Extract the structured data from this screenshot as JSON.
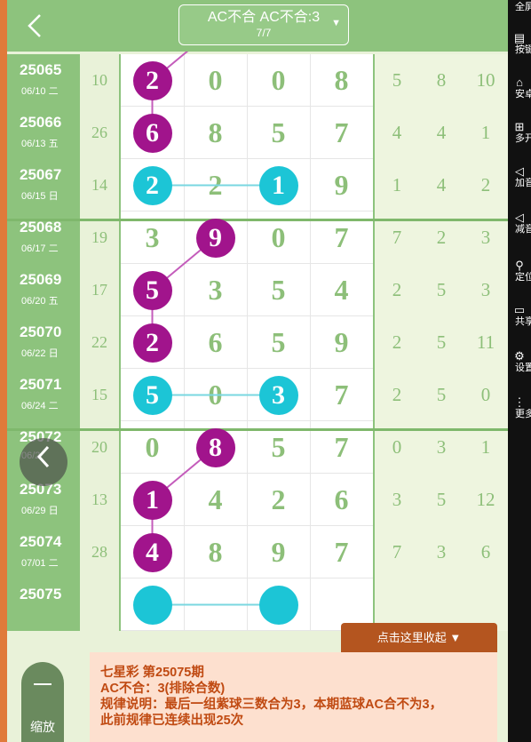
{
  "header": {
    "back_icon": "chevron-left-icon",
    "title": "AC不合 AC不合:3",
    "subtitle": "7/7",
    "dropdown_icon": "▼"
  },
  "rows": [
    {
      "issue": "25065",
      "date": "06/10 二",
      "sum": "10",
      "digits": [
        "2",
        "0",
        "0",
        "8"
      ],
      "side": [
        "5",
        "8",
        "10"
      ]
    },
    {
      "issue": "25066",
      "date": "06/13 五",
      "sum": "26",
      "digits": [
        "6",
        "8",
        "5",
        "7"
      ],
      "side": [
        "4",
        "4",
        "1"
      ]
    },
    {
      "issue": "25067",
      "date": "06/15 日",
      "sum": "14",
      "digits": [
        "2",
        "2",
        "1",
        "9"
      ],
      "side": [
        "1",
        "4",
        "2"
      ]
    },
    {
      "issue": "25068",
      "date": "06/17 二",
      "sum": "19",
      "digits": [
        "3",
        "9",
        "0",
        "7"
      ],
      "side": [
        "7",
        "2",
        "3"
      ]
    },
    {
      "issue": "25069",
      "date": "06/20 五",
      "sum": "17",
      "digits": [
        "5",
        "3",
        "5",
        "4"
      ],
      "side": [
        "2",
        "5",
        "3"
      ]
    },
    {
      "issue": "25070",
      "date": "06/22 日",
      "sum": "22",
      "digits": [
        "2",
        "6",
        "5",
        "9"
      ],
      "side": [
        "2",
        "5",
        "11"
      ]
    },
    {
      "issue": "25071",
      "date": "06/24 二",
      "sum": "15",
      "digits": [
        "5",
        "0",
        "3",
        "7"
      ],
      "side": [
        "2",
        "5",
        "0"
      ]
    },
    {
      "issue": "25072",
      "date": "06/2",
      "sum": "20",
      "digits": [
        "0",
        "8",
        "5",
        "7"
      ],
      "side": [
        "0",
        "3",
        "1"
      ]
    },
    {
      "issue": "25073",
      "date": "06/29 日",
      "sum": "13",
      "digits": [
        "1",
        "4",
        "2",
        "6"
      ],
      "side": [
        "3",
        "5",
        "12"
      ]
    },
    {
      "issue": "25074",
      "date": "07/01 二",
      "sum": "28",
      "digits": [
        "4",
        "8",
        "9",
        "7"
      ],
      "side": [
        "7",
        "3",
        "6"
      ]
    },
    {
      "issue": "25075",
      "date": "",
      "sum": "",
      "digits": [
        "",
        "",
        "",
        ""
      ],
      "side": [
        "",
        "",
        ""
      ]
    }
  ],
  "sidebar": {
    "items": [
      {
        "label": "全屏",
        "icon": "fullscreen-icon",
        "glyph": ""
      },
      {
        "label": "按键",
        "icon": "keyboard-icon",
        "glyph": "▤"
      },
      {
        "label": "安卓",
        "icon": "android-icon",
        "glyph": "⌂"
      },
      {
        "label": "多开",
        "icon": "multi-window-icon",
        "glyph": "⊞"
      },
      {
        "label": "加音",
        "icon": "volume-up-icon",
        "glyph": "◁"
      },
      {
        "label": "减音",
        "icon": "volume-down-icon",
        "glyph": "◁"
      },
      {
        "label": "定位",
        "icon": "location-icon",
        "glyph": "⚲"
      },
      {
        "label": "共享",
        "icon": "folder-icon",
        "glyph": "▭"
      },
      {
        "label": "设置",
        "icon": "gear-icon",
        "glyph": "⚙"
      },
      {
        "label": "更多",
        "icon": "more-icon",
        "glyph": "⋮"
      }
    ]
  },
  "controls": {
    "prev_icon": "‹",
    "zoom_label": "缩放",
    "collapse_label": "点击这里收起 ▼"
  },
  "info": {
    "line1": "七星彩 第25075期",
    "line2": "AC不合：3(排除合数)",
    "line3": "规律说明：最后一组紫球三数合为3，本期蓝球AC合不为3，",
    "line4": "此前规律已连续出现25次"
  },
  "colors": {
    "header_green": "#8dc37d",
    "purple_ball": "#a1148c",
    "cyan_ball": "#1cc5d6",
    "number_green": "#8dbf79",
    "collapse_orange": "#b4551f",
    "info_bg": "#fde0cf"
  }
}
